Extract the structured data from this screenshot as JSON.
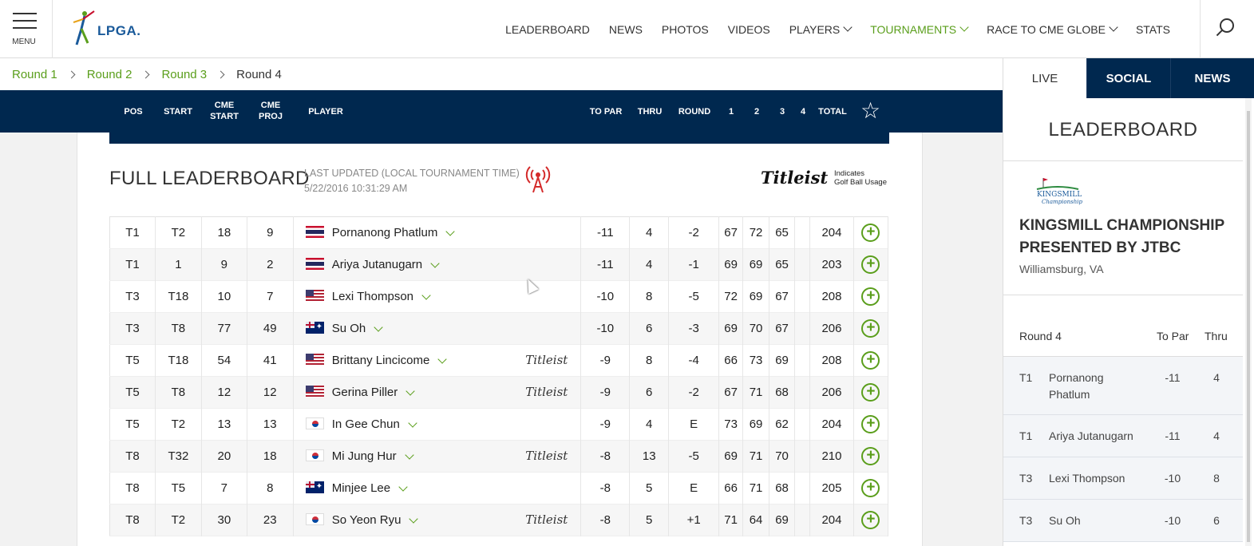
{
  "header": {
    "menu_label": "MENU",
    "logo_text": "LPGA.",
    "nav": [
      {
        "label": "LEADERBOARD",
        "dropdown": false,
        "active": false
      },
      {
        "label": "NEWS",
        "dropdown": false,
        "active": false
      },
      {
        "label": "PHOTOS",
        "dropdown": false,
        "active": false
      },
      {
        "label": "VIDEOS",
        "dropdown": false,
        "active": false
      },
      {
        "label": "PLAYERS",
        "dropdown": true,
        "active": false
      },
      {
        "label": "TOURNAMENTS",
        "dropdown": true,
        "active": true
      },
      {
        "label": "RACE TO CME GLOBE",
        "dropdown": true,
        "active": false
      },
      {
        "label": "STATS",
        "dropdown": false,
        "active": false
      }
    ]
  },
  "breadcrumbs": [
    "Round 1",
    "Round 2",
    "Round 3",
    "Round 4"
  ],
  "columns": {
    "pos": "POS",
    "start": "START",
    "cme_start": "CME START",
    "cme_proj": "CME PROJ",
    "player": "PLAYER",
    "to_par": "TO PAR",
    "thru": "THRU",
    "round": "ROUND",
    "r1": "1",
    "r2": "2",
    "r3": "3",
    "r4": "4",
    "total": "TOTAL"
  },
  "leaderboard": {
    "title": "FULL LEADERBOARD",
    "updated_label": "LAST UPDATED (LOCAL TOURNAMENT TIME)",
    "updated_value": "5/22/2016 10:31:29 AM",
    "titleist_logo": "Titleist",
    "titleist_note_1": "Indicates",
    "titleist_note_2": "Golf Ball Usage",
    "rows": [
      {
        "pos": "T1",
        "start": "T2",
        "cme_start": "18",
        "cme_proj": "9",
        "flag": "th",
        "player": "Pornanong Phatlum",
        "titleist": false,
        "to_par": "-11",
        "thru": "4",
        "round": "-2",
        "r1": "67",
        "r2": "72",
        "r3": "65",
        "r4": "",
        "total": "204"
      },
      {
        "pos": "T1",
        "start": "1",
        "cme_start": "9",
        "cme_proj": "2",
        "flag": "th",
        "player": "Ariya Jutanugarn",
        "titleist": false,
        "to_par": "-11",
        "thru": "4",
        "round": "-1",
        "r1": "69",
        "r2": "69",
        "r3": "65",
        "r4": "",
        "total": "203"
      },
      {
        "pos": "T3",
        "start": "T18",
        "cme_start": "10",
        "cme_proj": "7",
        "flag": "us",
        "player": "Lexi Thompson",
        "titleist": false,
        "to_par": "-10",
        "thru": "8",
        "round": "-5",
        "r1": "72",
        "r2": "69",
        "r3": "67",
        "r4": "",
        "total": "208"
      },
      {
        "pos": "T3",
        "start": "T8",
        "cme_start": "77",
        "cme_proj": "49",
        "flag": "au",
        "player": "Su Oh",
        "titleist": false,
        "to_par": "-10",
        "thru": "6",
        "round": "-3",
        "r1": "69",
        "r2": "70",
        "r3": "67",
        "r4": "",
        "total": "206"
      },
      {
        "pos": "T5",
        "start": "T18",
        "cme_start": "54",
        "cme_proj": "41",
        "flag": "us",
        "player": "Brittany Lincicome",
        "titleist": true,
        "to_par": "-9",
        "thru": "8",
        "round": "-4",
        "r1": "66",
        "r2": "73",
        "r3": "69",
        "r4": "",
        "total": "208"
      },
      {
        "pos": "T5",
        "start": "T8",
        "cme_start": "12",
        "cme_proj": "12",
        "flag": "us",
        "player": "Gerina Piller",
        "titleist": true,
        "to_par": "-9",
        "thru": "6",
        "round": "-2",
        "r1": "67",
        "r2": "71",
        "r3": "68",
        "r4": "",
        "total": "206"
      },
      {
        "pos": "T5",
        "start": "T2",
        "cme_start": "13",
        "cme_proj": "13",
        "flag": "kr",
        "player": "In Gee Chun",
        "titleist": false,
        "to_par": "-9",
        "thru": "4",
        "round": "E",
        "r1": "73",
        "r2": "69",
        "r3": "62",
        "r4": "",
        "total": "204"
      },
      {
        "pos": "T8",
        "start": "T32",
        "cme_start": "20",
        "cme_proj": "18",
        "flag": "kr",
        "player": "Mi Jung Hur",
        "titleist": true,
        "to_par": "-8",
        "thru": "13",
        "round": "-5",
        "r1": "69",
        "r2": "71",
        "r3": "70",
        "r4": "",
        "total": "210"
      },
      {
        "pos": "T8",
        "start": "T5",
        "cme_start": "7",
        "cme_proj": "8",
        "flag": "au",
        "player": "Minjee Lee",
        "titleist": false,
        "to_par": "-8",
        "thru": "5",
        "round": "E",
        "r1": "66",
        "r2": "71",
        "r3": "68",
        "r4": "",
        "total": "205"
      },
      {
        "pos": "T8",
        "start": "T2",
        "cme_start": "30",
        "cme_proj": "23",
        "flag": "kr",
        "player": "So Yeon Ryu",
        "titleist": true,
        "to_par": "-8",
        "thru": "5",
        "round": "+1",
        "r1": "71",
        "r2": "64",
        "r3": "69",
        "r4": "",
        "total": "204"
      }
    ]
  },
  "sidebar": {
    "tabs": [
      {
        "label": "LIVE",
        "active": true
      },
      {
        "label": "SOCIAL",
        "active": false
      },
      {
        "label": "NEWS",
        "active": false
      }
    ],
    "title": "LEADERBOARD",
    "tournament_logo_text": "KINGSMILL",
    "tournament_logo_sub": "Championship",
    "tournament_name": "KINGSMILL CHAMPIONSHIP PRESENTED BY JTBC",
    "location": "Williamsburg, VA",
    "round_label": "Round 4",
    "col_topar": "To Par",
    "col_thru": "Thru",
    "rows": [
      {
        "pos": "T1",
        "player": "Pornanong Phatlum",
        "to_par": "-11",
        "thru": "4"
      },
      {
        "pos": "T1",
        "player": "Ariya Jutanugarn",
        "to_par": "-11",
        "thru": "4"
      },
      {
        "pos": "T3",
        "player": "Lexi Thompson",
        "to_par": "-10",
        "thru": "8"
      },
      {
        "pos": "T3",
        "player": "Su Oh",
        "to_par": "-10",
        "thru": "6"
      }
    ]
  },
  "colors": {
    "navy": "#00284f",
    "green": "#5a9e1b"
  }
}
